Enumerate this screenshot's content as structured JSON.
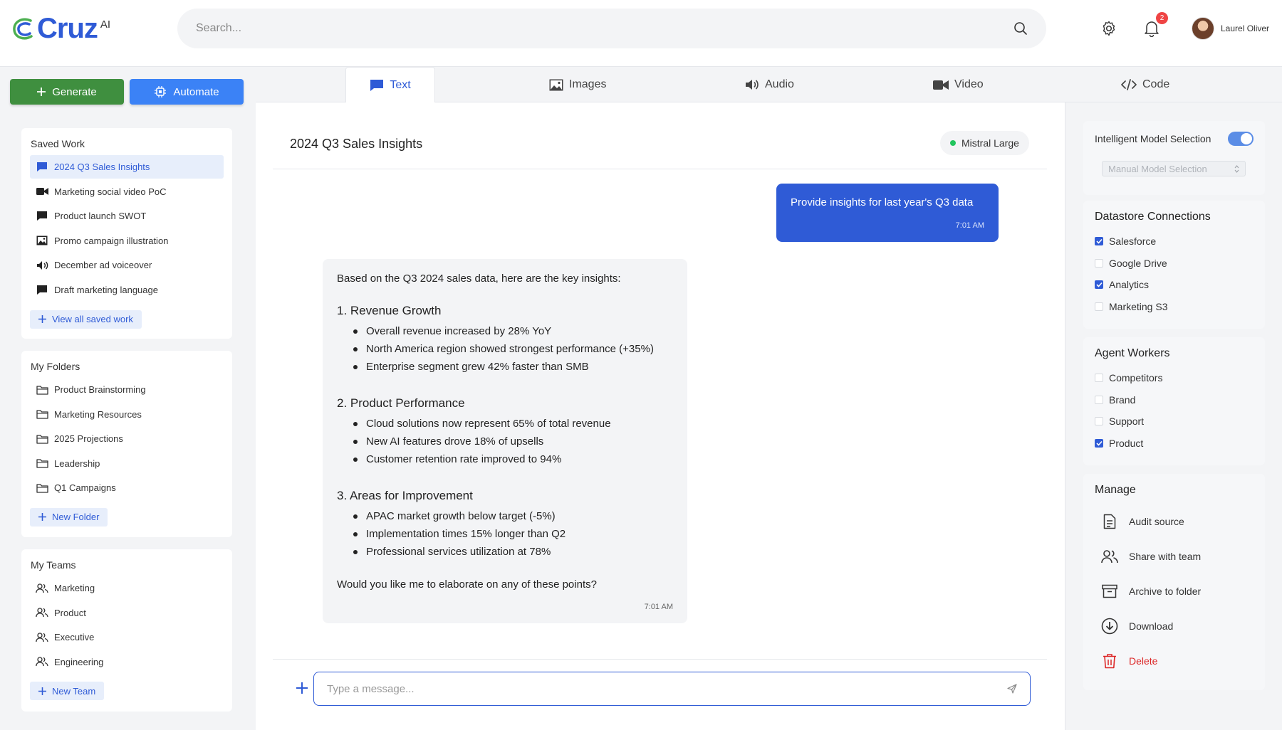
{
  "header": {
    "logo_text": "Cruz",
    "logo_sup": "AI",
    "search_placeholder": "Search...",
    "notification_count": "2",
    "user_name": "Laurel Oliver"
  },
  "actions": {
    "generate_label": "Generate",
    "automate_label": "Automate"
  },
  "saved_work": {
    "title": "Saved Work",
    "items": [
      {
        "label": "2024 Q3 Sales Insights",
        "icon": "chat-icon"
      },
      {
        "label": "Marketing social video PoC",
        "icon": "video-icon"
      },
      {
        "label": "Product launch SWOT",
        "icon": "chat-icon"
      },
      {
        "label": "Promo campaign illustration",
        "icon": "image-icon"
      },
      {
        "label": "December ad voiceover",
        "icon": "audio-icon"
      },
      {
        "label": "Draft marketing language",
        "icon": "chat-icon"
      }
    ],
    "add_label": "View all saved work"
  },
  "folders": {
    "title": "My Folders",
    "items": [
      "Product Brainstorming",
      "Marketing Resources",
      "2025 Projections",
      "Leadership",
      "Q1 Campaigns"
    ],
    "add_label": "New Folder"
  },
  "teams": {
    "title": "My Teams",
    "items": [
      "Marketing",
      "Product",
      "Executive",
      "Engineering"
    ],
    "add_label": "New Team"
  },
  "tabs": [
    "Text",
    "Images",
    "Audio",
    "Video",
    "Code"
  ],
  "chat": {
    "title": "2024 Q3 Sales Insights",
    "model": "Mistral Large",
    "user_message": "Provide insights for last year's Q3 data",
    "user_time": "7:01 AM",
    "ai_intro": "Based on the Q3 2024 sales data, here are the key insights:",
    "sections": [
      {
        "heading": "1. Revenue Growth",
        "bullets": [
          "Overall revenue increased by 28% YoY",
          "North America region showed strongest performance (+35%)",
          "Enterprise segment grew 42% faster than SMB"
        ]
      },
      {
        "heading": "2. Product Performance",
        "bullets": [
          "Cloud solutions now represent 65% of total revenue",
          "New AI features drove 18% of upsells",
          "Customer retention rate improved to 94%"
        ]
      },
      {
        "heading": "3. Areas for Improvement",
        "bullets": [
          "APAC market growth below target (-5%)",
          "Implementation times 15% longer than Q2",
          "Professional services utilization at 78%"
        ]
      }
    ],
    "ai_outro": "Would you like me to elaborate on any of these points?",
    "ai_time": "7:01 AM",
    "composer_placeholder": "Type a message..."
  },
  "settings": {
    "intelligent_label": "Intelligent Model Selection",
    "intelligent_on": true,
    "manual_label": "Manual Model Selection"
  },
  "datastore": {
    "title": "Datastore Connections",
    "items": [
      {
        "label": "Salesforce",
        "checked": true
      },
      {
        "label": "Google Drive",
        "checked": false
      },
      {
        "label": "Analytics",
        "checked": true
      },
      {
        "label": "Marketing S3",
        "checked": false
      }
    ]
  },
  "agents": {
    "title": "Agent Workers",
    "items": [
      {
        "label": "Competitors",
        "checked": false
      },
      {
        "label": "Brand",
        "checked": false
      },
      {
        "label": "Support",
        "checked": false
      },
      {
        "label": "Product",
        "checked": true
      }
    ]
  },
  "manage": {
    "title": "Manage",
    "items": [
      {
        "label": "Audit source",
        "icon": "document-icon"
      },
      {
        "label": "Share with team",
        "icon": "users-icon"
      },
      {
        "label": "Archive to folder",
        "icon": "archive-icon"
      },
      {
        "label": "Download",
        "icon": "download-icon"
      },
      {
        "label": "Delete",
        "icon": "trash-icon"
      }
    ]
  },
  "colors": {
    "brand_blue": "#2f5bd6",
    "generate_green": "#3f8f3f",
    "automate_blue": "#3b82f6",
    "danger_red": "#dc2626"
  }
}
